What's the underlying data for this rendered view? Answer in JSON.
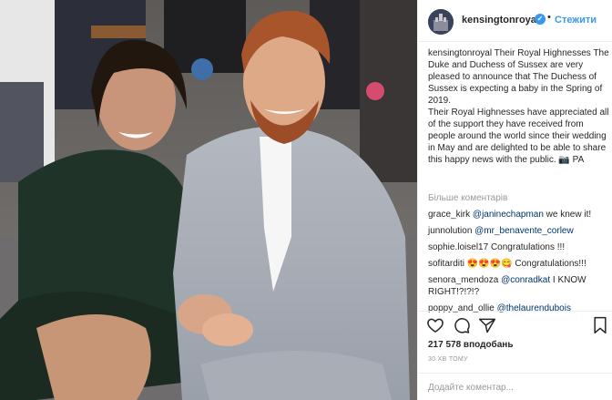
{
  "post": {
    "username": "kensingtonroyal",
    "follow_label": "Стежити",
    "separator": "•",
    "caption_lines": [
      "kensingtonroyal Their Royal Highnesses The Duke and Duchess of Sussex are very pleased to announce that The Duchess of Sussex is expecting a baby in the Spring of 2019.",
      "Their Royal Highnesses have appreciated all of the support they have received from people around the world since their wedding in May and are delighted to be able to share this happy news with the public. 📷 PA"
    ],
    "more_comments_label": "Більше коментарів",
    "likes": "217 578 вподобань",
    "time_ago": "30 ХВ ТОМУ",
    "add_comment_placeholder": "Додайте коментар..."
  },
  "comments": [
    {
      "user": "grace_kirk",
      "mention": "@janinechapman",
      "text": " we knew it!"
    },
    {
      "user": "junnolution",
      "mention": "@mr_benavente_corlew",
      "text": ""
    },
    {
      "user": "sophie.loisel17",
      "mention": "",
      "text": "Congratulations !!!"
    },
    {
      "user": "sofitarditi",
      "mention": "",
      "text": "😍😍😍😋 Congratulations!!!"
    },
    {
      "user": "senora_mendoza",
      "mention": "@conradkat",
      "text": " I KNOW RIGHT!?!?!?"
    },
    {
      "user": "poppy_and_ollie",
      "mention": "@thelaurendubois",
      "text": ""
    }
  ],
  "icons": {
    "verified": "verified-badge-icon",
    "like": "heart-icon",
    "comment": "comment-bubble-icon",
    "share": "share-icon",
    "save": "bookmark-icon"
  },
  "colors": {
    "link": "#003569",
    "follow": "#3897f0",
    "muted": "#999999"
  }
}
